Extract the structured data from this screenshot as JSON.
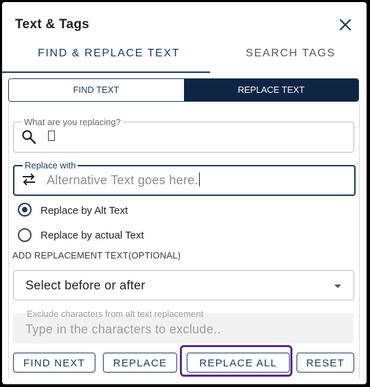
{
  "header": {
    "title": "Text & Tags"
  },
  "tabs": [
    {
      "label": "FIND & REPLACE TEXT",
      "active": true
    },
    {
      "label": "SEARCH TAGS",
      "active": false
    }
  ],
  "mode_toggle": [
    {
      "label": "FIND TEXT",
      "active": false
    },
    {
      "label": "REPLACE TEXT",
      "active": true
    }
  ],
  "find_field": {
    "legend": "What are you replacing?",
    "value": ""
  },
  "replace_field": {
    "legend": "Replace with",
    "placeholder": "Alternative Text goes here."
  },
  "radio_options": [
    {
      "label": "Replace by Alt Text",
      "checked": true
    },
    {
      "label": "Replace by actual Text",
      "checked": false
    }
  ],
  "replacement_section": {
    "heading": "ADD REPLACEMENT TEXT(OPTIONAL)",
    "select_value": "Select before or after"
  },
  "exclude_field": {
    "legend": "Exclude characters from alt text replacement",
    "placeholder": "Type in the characters to exclude.."
  },
  "buttons": {
    "find_next": "FIND NEXT",
    "replace": "REPLACE",
    "replace_all": "REPLACE ALL",
    "reset": "RESET"
  },
  "colors": {
    "primary": "#1b3a5c",
    "active_segment": "#0f2544",
    "focus_ring": "#5b2a86"
  }
}
